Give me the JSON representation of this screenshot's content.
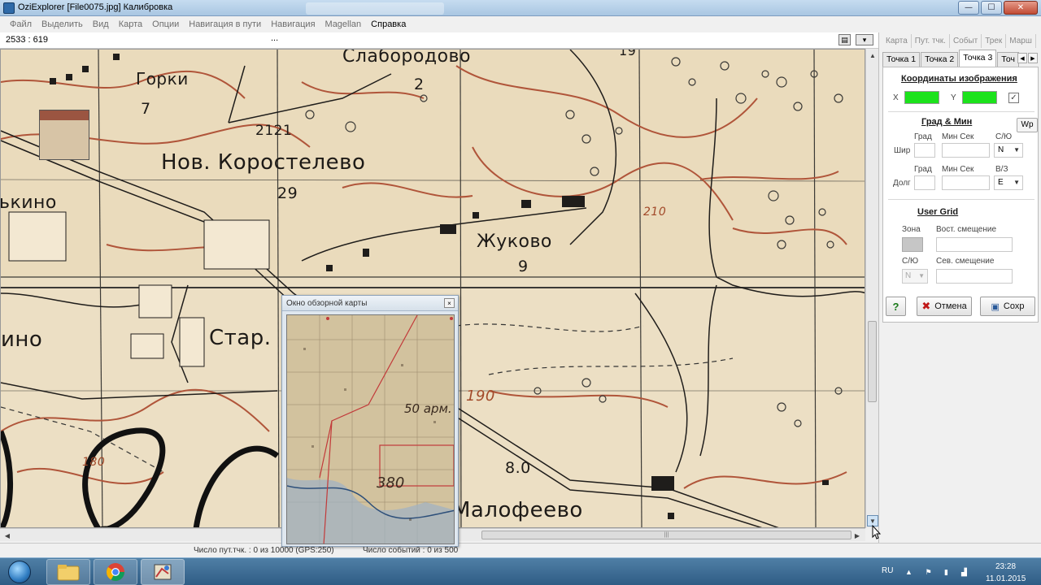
{
  "window": {
    "title": "OziExplorer [File0075.jpg] Калибровка",
    "controls": {
      "minimize": "—",
      "maximize": "☐",
      "close": "✕"
    }
  },
  "menu": [
    "Файл",
    "Выделить",
    "Вид",
    "Карта",
    "Опции",
    "Навигация в пути",
    "Навигация",
    "Magellan",
    "Справка"
  ],
  "coordbar": {
    "position": "2533 : 619",
    "dots": "..."
  },
  "map": {
    "labels": {
      "slaborodovo": "Слабородово",
      "gorki": "Горки",
      "gorki_num": "7",
      "slab_num": "2",
      "elev_2121": "2121",
      "nov_korostelevo": "Нов. Коростелево",
      "num_29": "29",
      "kino_top": "ькино",
      "zhukovo": "Жуково",
      "zhukovo_num": "9",
      "elev_210": "210",
      "star": "Стар.",
      "kino_bottom": "ино",
      "elev_190": "190",
      "elev_180": "180",
      "road_num": "8.0",
      "malofeevo": "Малофеево",
      "num_19": "19"
    }
  },
  "overview": {
    "title": "Окно обзорной карты",
    "close": "×",
    "labels": {
      "army": "50 арм.",
      "num": "380"
    }
  },
  "status": {
    "track_points": "Число пут.тчк. : 0 из 10000  (GPS:250)",
    "events": "Число событий : 0 из 500"
  },
  "panel": {
    "top_tabs": [
      "Карта",
      "Пут. тчк.",
      "Событ",
      "Трек",
      "Марш"
    ],
    "point_tabs": [
      "Точка 1",
      "Точка 2",
      "Точка 3",
      "Точ"
    ],
    "image_coords": {
      "title": "Координаты изображения",
      "x_label": "X",
      "y_label": "Y",
      "checked": "✓"
    },
    "deg_min": {
      "title": "Град & Мин",
      "wp_button": "Wp",
      "lat": {
        "label": "Шир",
        "deg_header": "Град",
        "minsec_header": "Мин Сек",
        "hemi_header": "С/Ю",
        "hemi_value": "N"
      },
      "lon": {
        "label": "Долг",
        "deg_header": "Град",
        "minsec_header": "Мин Сек",
        "hemi_header": "В/З",
        "hemi_value": "E"
      }
    },
    "user_grid": {
      "title": "User Grid",
      "zone_label": "Зона",
      "east_label": "Вост. смещение",
      "ns_label": "С/Ю",
      "ns_value": "N",
      "north_label": "Сев. смещение"
    },
    "buttons": {
      "help": "?",
      "cancel": "Отмена",
      "save": "Сохр"
    }
  },
  "taskbar": {
    "lang": "RU",
    "time": "23:28",
    "date": "11.01.2015"
  },
  "colors": {
    "green_field": "#1ce21c",
    "map_paper": "#ecdfc4",
    "contour": "#b0553a"
  }
}
